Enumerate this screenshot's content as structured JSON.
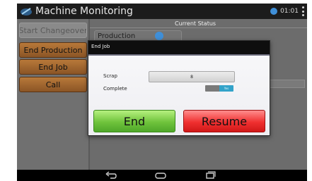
{
  "app": {
    "title": "Machine Monitoring",
    "clock": "01:01"
  },
  "left_panel": {
    "buttons": [
      {
        "label": "Start Changeover",
        "state": "disabled"
      },
      {
        "label": "End Production",
        "state": "enabled"
      },
      {
        "label": "End Job",
        "state": "enabled"
      },
      {
        "label": "Call",
        "state": "enabled"
      }
    ]
  },
  "right_panel": {
    "header": "Current Status",
    "production_label": "Production"
  },
  "dialog": {
    "title": "End Job",
    "scrap_label": "Scrap",
    "scrap_value": "8",
    "complete_label": "Complete",
    "complete_toggle": "Yes",
    "end_button": "End",
    "resume_button": "Resume"
  },
  "navigation": {
    "icons": [
      "back-icon",
      "home-icon",
      "recent-apps-icon"
    ]
  },
  "colors": {
    "end_button": "#6fc33c",
    "resume_button": "#f03030",
    "toggle_on": "#33a3c9"
  }
}
